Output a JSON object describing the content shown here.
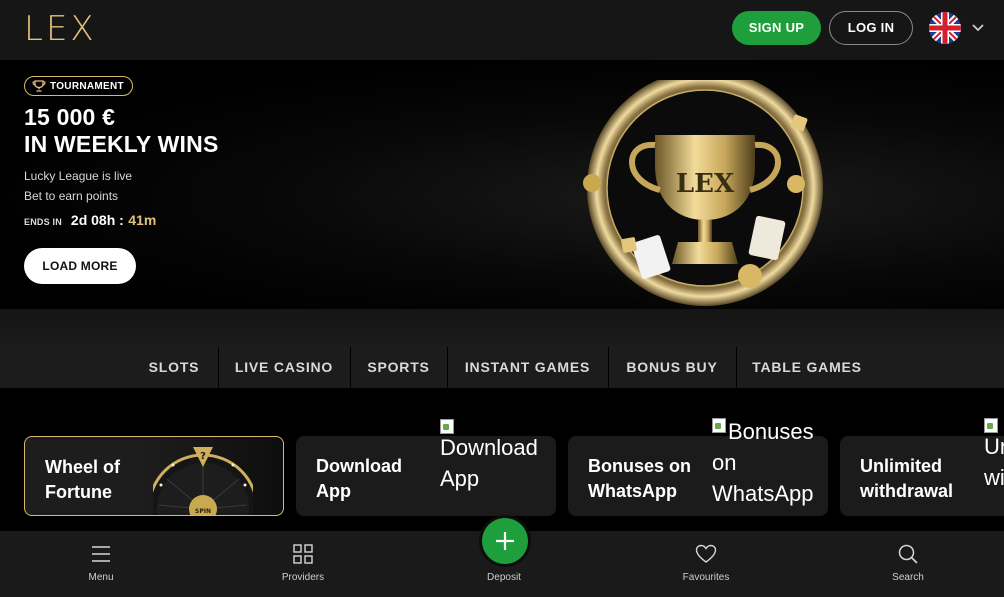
{
  "header": {
    "logo": "LEX",
    "signup_label": "SIGN UP",
    "login_label": "LOG IN",
    "language": "English (UK flag)"
  },
  "hero": {
    "badge": "TOURNAMENT",
    "title_line1": "15 000 €",
    "title_line2": "IN WEEKLY WINS",
    "subtitle_line1": "Lucky League is live",
    "subtitle_line2": "Bet to earn points",
    "ends_label": "ENDS IN",
    "ends_value": "2d 08h :",
    "ends_minutes": "41m",
    "cta_label": "LOAD MORE",
    "art_text": "LEX"
  },
  "categories": [
    "SLOTS",
    "LIVE CASINO",
    "SPORTS",
    "INSTANT GAMES",
    "BONUS BUY",
    "TABLE GAMES"
  ],
  "promos": [
    {
      "title_line1": "Wheel of",
      "title_line2": "Fortune",
      "image_label": "SPIN"
    },
    {
      "title_line1": "Download",
      "title_line2": "App",
      "alt_line1": "Download",
      "alt_line2": "App"
    },
    {
      "title_line1": "Bonuses on",
      "title_line2": "WhatsApp",
      "alt_line1": "Bonuses",
      "alt_line2": "on",
      "alt_line3": "WhatsApp"
    },
    {
      "title_line1": "Unlimited",
      "title_line2": "withdrawal",
      "alt_line1": "Un",
      "alt_line2": "wi"
    }
  ],
  "bottom_nav": {
    "menu": "Menu",
    "providers": "Providers",
    "deposit": "Deposit",
    "favourites": "Favourites",
    "search": "Search"
  },
  "colors": {
    "gold": "#e0c27a",
    "green": "#1f9e3c",
    "header_bg": "#161616",
    "bar_bg": "#1c1c1c"
  }
}
